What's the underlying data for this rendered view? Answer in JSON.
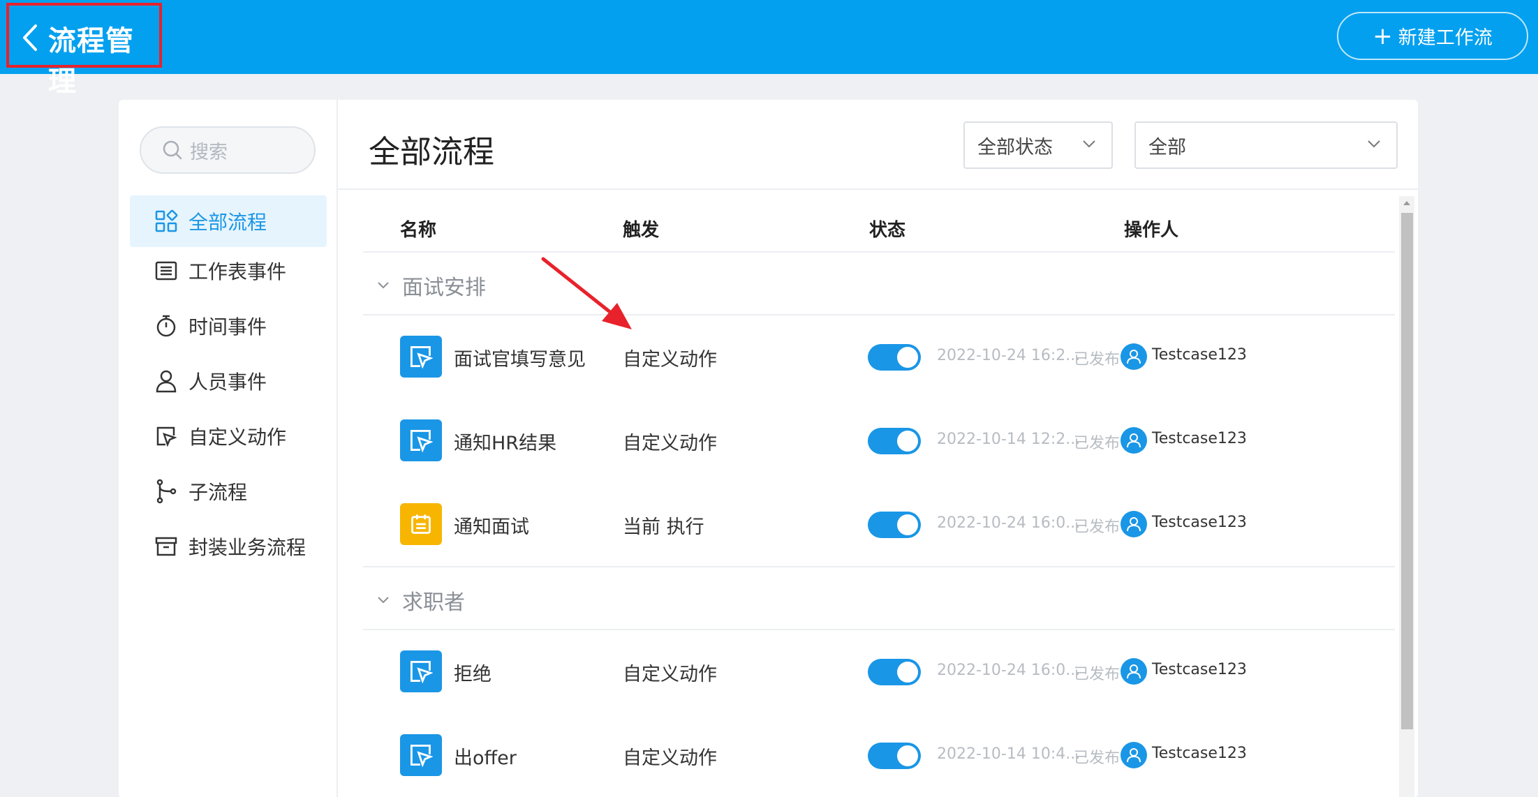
{
  "header": {
    "title": "流程管理",
    "new_button_label": "新建工作流",
    "background_color": "#03a0ef"
  },
  "sidebar": {
    "search_placeholder": "搜索",
    "items": [
      {
        "label": "全部流程",
        "icon": "grid-icon",
        "active": true
      },
      {
        "label": "工作表事件",
        "icon": "list-icon",
        "active": false
      },
      {
        "label": "时间事件",
        "icon": "stopwatch-icon",
        "active": false
      },
      {
        "label": "人员事件",
        "icon": "person-icon",
        "active": false
      },
      {
        "label": "自定义动作",
        "icon": "cursor-box-icon",
        "active": false
      },
      {
        "label": "子流程",
        "icon": "branch-icon",
        "active": false
      },
      {
        "label": "封装业务流程",
        "icon": "archive-icon",
        "active": false
      }
    ]
  },
  "main": {
    "title": "全部流程",
    "status_filter": "全部状态",
    "type_filter": "全部",
    "columns": [
      "名称",
      "触发",
      "状态",
      "操作人"
    ],
    "groups": [
      {
        "name": "面试安排",
        "rows": [
          {
            "name": "面试官填写意见",
            "trigger": "自定义动作",
            "enabled": true,
            "date": "2022-10-24 16:2...",
            "status": "已发布",
            "operator": "Testcase123",
            "icon": "cursor-box-icon",
            "icon_color": "#1a96e6"
          },
          {
            "name": "通知HR结果",
            "trigger": "自定义动作",
            "enabled": true,
            "date": "2022-10-14 12:2...",
            "status": "已发布",
            "operator": "Testcase123",
            "icon": "cursor-box-icon",
            "icon_color": "#1a96e6"
          },
          {
            "name": "通知面试",
            "trigger": "当前 执行",
            "enabled": true,
            "date": "2022-10-24 16:0...",
            "status": "已发布",
            "operator": "Testcase123",
            "icon": "calendar-icon",
            "icon_color": "#f7b500"
          }
        ]
      },
      {
        "name": "求职者",
        "rows": [
          {
            "name": "拒绝",
            "trigger": "自定义动作",
            "enabled": true,
            "date": "2022-10-24 16:0...",
            "status": "已发布",
            "operator": "Testcase123",
            "icon": "cursor-box-icon",
            "icon_color": "#1a96e6"
          },
          {
            "name": "出offer",
            "trigger": "自定义动作",
            "enabled": true,
            "date": "2022-10-14 10:4...",
            "status": "已发布",
            "operator": "Testcase123",
            "icon": "cursor-box-icon",
            "icon_color": "#1a96e6"
          }
        ]
      }
    ]
  },
  "colors": {
    "accent": "#1a96e6",
    "highlight_box": "#e8222b",
    "annotation_arrow": "#e8222b"
  }
}
